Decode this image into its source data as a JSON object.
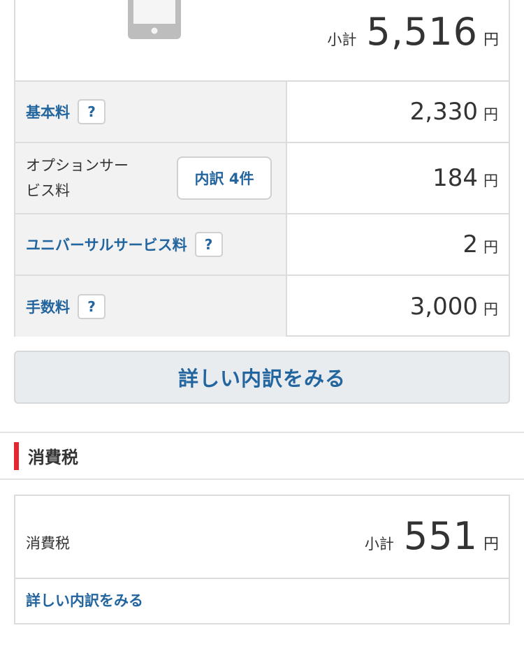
{
  "summary": {
    "subtotal_label": "小計",
    "subtotal_value": "5,516",
    "currency": "円",
    "device_icon": "smartphone-icon"
  },
  "fees": [
    {
      "label": "基本料",
      "value": "2,330",
      "unit": "円",
      "help": "?"
    },
    {
      "label": "オプションサービス料",
      "line1": "オプションサー",
      "line2": "ビス料",
      "value": "184",
      "unit": "円",
      "button": "内訳 4件"
    },
    {
      "label": "ユニバーサルサービス料",
      "value": "2",
      "unit": "円",
      "help": "?"
    },
    {
      "label": "手数料",
      "value": "3,000",
      "unit": "円",
      "help": "?"
    }
  ],
  "detail_button": "詳しい内訳をみる",
  "tax_section": {
    "title": "消費税",
    "name": "消費税",
    "subtotal_label": "小計",
    "subtotal_value": "551",
    "currency": "円",
    "link": "詳しい内訳をみる"
  },
  "colors": {
    "link": "#23659e",
    "accent_bar": "#e3262f",
    "label_bg": "#f2f2f2",
    "border": "#dcdcdc"
  }
}
